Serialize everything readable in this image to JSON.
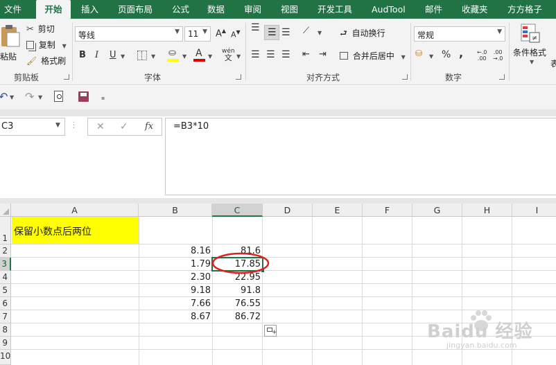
{
  "ribbon_tabs": [
    "文件",
    "开始",
    "插入",
    "页面布局",
    "公式",
    "数据",
    "审阅",
    "视图",
    "开发工具",
    "AudTool",
    "邮件",
    "收藏夹",
    "方方格子"
  ],
  "active_tab": "开始",
  "clipboard": {
    "paste": "粘贴",
    "cut": "剪切",
    "copy": "复制",
    "format_painter": "格式刷",
    "label": "剪贴板"
  },
  "font": {
    "name": "等线",
    "size": "11",
    "bold": "B",
    "italic": "I",
    "underline": "U",
    "fill_icon": "fill-color-icon",
    "font_color_letter": "A",
    "phonetic": "wén",
    "label": "字体",
    "fill_color": "#ffff00",
    "font_color": "#e00000"
  },
  "alignment": {
    "wrap_text": "自动换行",
    "merge_center": "合并后居中",
    "label": "对齐方式"
  },
  "number": {
    "format": "常规",
    "percent": "%",
    "comma": ",",
    "label": "数字"
  },
  "styles": {
    "conditional_format": "条件格式",
    "table_partial": "表"
  },
  "formula_bar": {
    "name_box": "C3",
    "formula": "=B3*10",
    "cancel": "✕",
    "enter": "✓",
    "fx": "fx"
  },
  "columns": [
    "A",
    "B",
    "C",
    "D",
    "E",
    "F",
    "G",
    "H",
    "I"
  ],
  "rows": [
    "1",
    "2",
    "3",
    "4",
    "5",
    "6",
    "7",
    "8",
    "9",
    "10"
  ],
  "cells": {
    "A1": "保留小数点后两位",
    "B": [
      "8.16",
      "1.79",
      "2.30",
      "9.18",
      "7.66",
      "8.67"
    ],
    "C": [
      "81.6",
      "17.85",
      "22.95",
      "91.8",
      "76.55",
      "86.72"
    ]
  },
  "colors": {
    "excel_green": "#217346",
    "highlight_yellow": "#ffff00",
    "annotation_red": "#e02020"
  },
  "watermark": {
    "brand": "Baidu 经验",
    "url": "jingyan.baidu.com"
  }
}
